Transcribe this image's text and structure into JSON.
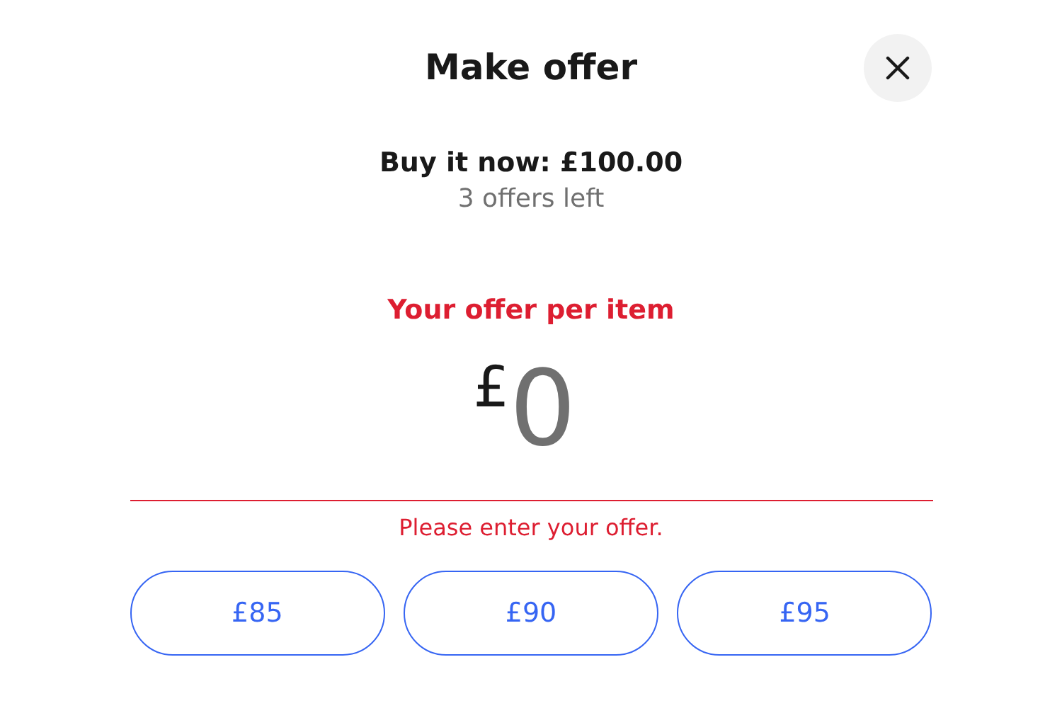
{
  "dialog": {
    "title": "Make offer"
  },
  "listing": {
    "buy_it_now": "Buy it now: £100.00",
    "offers_left": "3 offers left"
  },
  "offer_field": {
    "label": "Your offer per item",
    "currency": "£",
    "placeholder": "0",
    "error": true,
    "error_message": "Please enter your offer."
  },
  "suggestions": [
    {
      "label": "£85"
    },
    {
      "label": "£90"
    },
    {
      "label": "£95"
    }
  ]
}
